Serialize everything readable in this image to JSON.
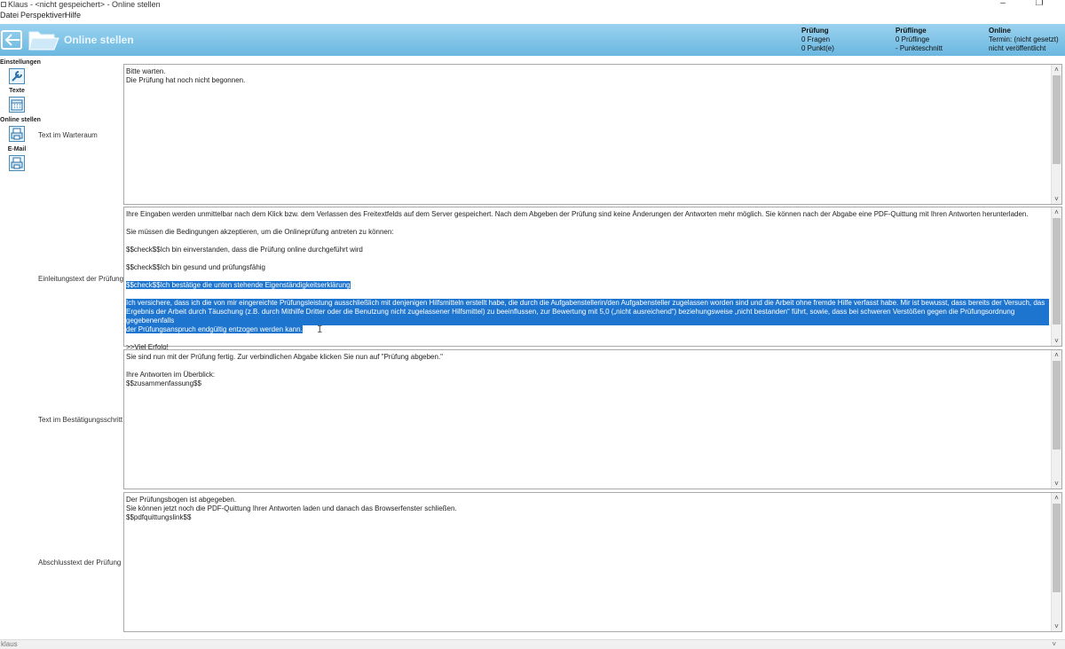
{
  "window": {
    "title": "Klaus - <nicht gespeichert> - Online stellen",
    "minimize": "–",
    "restore": "❐"
  },
  "menu": [
    "Datei",
    "Perspektiven",
    "Hilfe"
  ],
  "header": {
    "title": "Online stellen",
    "stats": [
      {
        "heading": "Prüfung",
        "line1": "0 Fragen",
        "line2": "0 Punkt(e)"
      },
      {
        "heading": "Prüflinge",
        "line1": "0 Prüflinge",
        "line2": "- Punkteschnitt"
      },
      {
        "heading": "Online",
        "line1": "Termin: (nicht gesetzt)",
        "line2": "nicht veröffentlicht"
      }
    ]
  },
  "nav": [
    {
      "label": "Einstellungen",
      "icon": "wrench-icon"
    },
    {
      "label": "Texte",
      "icon": "calendar-icon"
    },
    {
      "label": "Online stellen",
      "icon": "printer-icon"
    },
    {
      "label": "E-Mail",
      "icon": "mail-icon"
    }
  ],
  "sections": {
    "waiting": {
      "label": "Text im Warteraum",
      "lines": [
        "Bitte warten.",
        "Die Prüfung hat noch nicht begonnen."
      ]
    },
    "intro": {
      "label": "Einleitungstext der Prüfung",
      "line1": "Ihre Eingaben werden unmittelbar nach dem Klick bzw. dem Verlassen des Freitextfelds auf dem Server gespeichert. Nach dem Abgeben der Prüfung sind keine Änderungen der Antworten mehr möglich. Sie können nach der Abgabe eine PDF-Quittung mit Ihren Antworten herunterladen.",
      "line2": "Sie müssen die Bedingungen akzeptieren, um die Onlineprüfung antreten zu können:",
      "check1": "$$check$$Ich bin einverstanden, dass die Prüfung online durchgeführt wird",
      "check2": "$$check$$Ich bin gesund und prüfungsfähig",
      "check3": "$$check$$Ich bestätige die unten stehende Eigenständigkeitserklärung",
      "decl1": "Ich versichere, dass ich die von mir eingereichte Prüfungsleistung ausschließlich mit denjenigen Hilfsmitteln erstellt habe, die durch die Aufgabenstellerin/den Aufgabensteller zugelassen worden sind und die Arbeit ohne fremde Hilfe verfasst habe. Mir ist bewusst, dass bereits der Versuch, das",
      "decl2": "Ergebnis der Arbeit durch Täuschung (z.B. durch Mithilfe Dritter oder die Benutzung nicht zugelassener Hilfsmittel) zu beeinflussen, zur Bewertung mit 5,0 („nicht ausreichend“) beziehungsweise „nicht bestanden“ führt, sowie, dass bei schweren Verstößen gegen die Prüfungsordnung gegebenenfalls",
      "decl3": "der Prüfungsanspruch endgültig entzogen werden kann.",
      "closing": ">>Viel Erfolg!"
    },
    "confirm": {
      "label": "Text im Bestätigungsschritt",
      "line1": "Sie sind nun mit der Prüfung fertig. Zur verbindlichen Abgabe klicken Sie nun auf \"Prüfung abgeben.\"",
      "line2": "Ihre Antworten im Überblick:",
      "line3": "$$zusammenfassung$$"
    },
    "final": {
      "label": "Abschlusstext der Prüfung",
      "line1": "Der Prüfungsbogen ist abgegeben.",
      "line2": "Sie können jetzt noch die PDF-Quittung Ihrer Antworten laden und danach das Browserfenster schließen.",
      "line3": "$$pdfquittungslink$$"
    }
  },
  "statusbar": {
    "text": "klaus"
  }
}
